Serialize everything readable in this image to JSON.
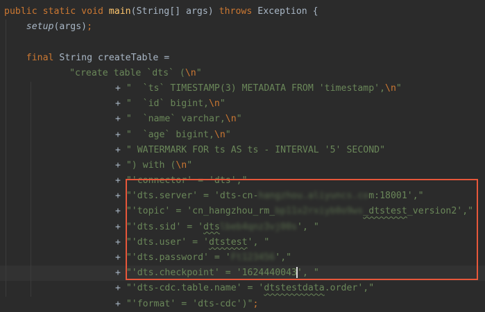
{
  "editor": {
    "language": "java",
    "current_line_index": 17,
    "highlight_color": "#e8573a",
    "lines": [
      [
        [
          "kw",
          "public static void "
        ],
        [
          "fn",
          "main"
        ],
        [
          "id",
          "(String[] args) "
        ],
        [
          "kw",
          "throws "
        ],
        [
          "id",
          "Exception {"
        ]
      ],
      [
        [
          "id",
          "    "
        ],
        [
          "it",
          "setup"
        ],
        [
          "id",
          "(args)"
        ],
        [
          "kw",
          ";"
        ]
      ],
      [],
      [
        [
          "id",
          "    "
        ],
        [
          "kw",
          "final "
        ],
        [
          "id",
          "String createTable ="
        ]
      ],
      [
        [
          "id",
          "          "
        ],
        [
          "str",
          "\"create table `dts` ("
        ],
        [
          "esc",
          "\\n"
        ],
        [
          "str",
          "\""
        ]
      ],
      [
        [
          "id",
          "                 "
        ],
        [
          "op",
          "+ "
        ],
        [
          "str",
          "\"  `ts` TIMESTAMP(3) METADATA FROM 'timestamp',"
        ],
        [
          "esc",
          "\\n"
        ],
        [
          "str",
          "\""
        ]
      ],
      [
        [
          "id",
          "                 "
        ],
        [
          "op",
          "+ "
        ],
        [
          "str",
          "\"  `id` bigint,"
        ],
        [
          "esc",
          "\\n"
        ],
        [
          "str",
          "\""
        ]
      ],
      [
        [
          "id",
          "                 "
        ],
        [
          "op",
          "+ "
        ],
        [
          "str",
          "\"  `name` varchar,"
        ],
        [
          "esc",
          "\\n"
        ],
        [
          "str",
          "\""
        ]
      ],
      [
        [
          "id",
          "                 "
        ],
        [
          "op",
          "+ "
        ],
        [
          "str",
          "\"  `age` bigint,"
        ],
        [
          "esc",
          "\\n"
        ],
        [
          "str",
          "\""
        ]
      ],
      [
        [
          "id",
          "                 "
        ],
        [
          "op",
          "+ "
        ],
        [
          "str",
          "\" WATERMARK FOR ts AS ts - INTERVAL '5' SECOND\""
        ]
      ],
      [
        [
          "id",
          "                 "
        ],
        [
          "op",
          "+ "
        ],
        [
          "str",
          "\") with ("
        ],
        [
          "esc",
          "\\n"
        ],
        [
          "str",
          "\""
        ]
      ],
      [
        [
          "id",
          "                 "
        ],
        [
          "op",
          "+ "
        ],
        [
          "str",
          "\"'connector' = 'dts',\""
        ]
      ],
      [
        [
          "id",
          "                 "
        ],
        [
          "op",
          "+ "
        ],
        [
          "str",
          "\"'dts.server' = 'dts-cn-"
        ],
        [
          "blur",
          "hangzhou.aliyuncs.co"
        ],
        [
          "str",
          "m:18001',\""
        ]
      ],
      [
        [
          "id",
          "                 "
        ],
        [
          "op",
          "+ "
        ],
        [
          "str",
          "\"'topic' = 'cn_hangzhou_rm_"
        ],
        [
          "blur",
          "bp11x2rxiyb0o9ws"
        ],
        [
          "sq",
          "_dtstest"
        ],
        [
          "str",
          "_version2',\""
        ]
      ],
      [
        [
          "id",
          "                 "
        ],
        [
          "op",
          "+ "
        ],
        [
          "str",
          "\"'dts.sid' = '"
        ],
        [
          "sq",
          "dts"
        ],
        [
          "blur",
          "lbeb4qnz3vj00s"
        ],
        [
          "str",
          "', \""
        ]
      ],
      [
        [
          "id",
          "                 "
        ],
        [
          "op",
          "+ "
        ],
        [
          "str",
          "\"'dts.user' = '"
        ],
        [
          "sq",
          "dtstest"
        ],
        [
          "str",
          "', \""
        ]
      ],
      [
        [
          "id",
          "                 "
        ],
        [
          "op",
          "+ "
        ],
        [
          "str",
          "\"'dts.password' = '"
        ],
        [
          "blur",
          "Ft123456"
        ],
        [
          "str",
          "',\""
        ]
      ],
      [
        [
          "id",
          "                 "
        ],
        [
          "op",
          "+ "
        ],
        [
          "str",
          "\"'dts.checkpoint' = '1624440043"
        ],
        [
          "caret",
          ""
        ],
        [
          "str",
          "', \""
        ]
      ],
      [
        [
          "id",
          "                 "
        ],
        [
          "op",
          "+ "
        ],
        [
          "str",
          "\"'dts-cdc.table.name' = '"
        ],
        [
          "sq",
          "dtstestdata"
        ],
        [
          "str",
          ".order',\""
        ]
      ],
      [
        [
          "id",
          "                 "
        ],
        [
          "op",
          "+ "
        ],
        [
          "str",
          "\"'format' = 'dts-cdc')\""
        ],
        [
          "kw",
          ";"
        ]
      ]
    ]
  }
}
